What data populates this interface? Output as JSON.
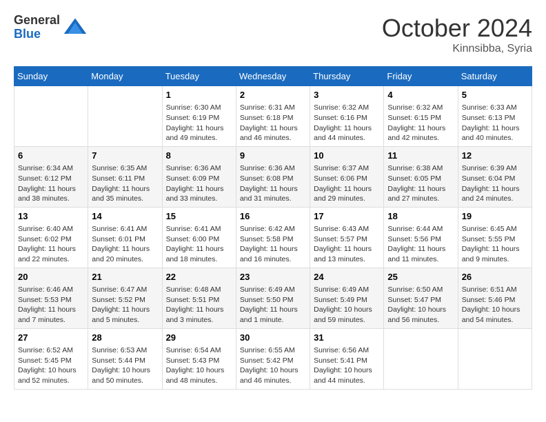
{
  "logo": {
    "general": "General",
    "blue": "Blue"
  },
  "title": {
    "month_year": "October 2024",
    "location": "Kinnsibba, Syria"
  },
  "weekdays": [
    "Sunday",
    "Monday",
    "Tuesday",
    "Wednesday",
    "Thursday",
    "Friday",
    "Saturday"
  ],
  "weeks": [
    [
      {
        "day": null
      },
      {
        "day": null
      },
      {
        "day": "1",
        "sunrise": "Sunrise: 6:30 AM",
        "sunset": "Sunset: 6:19 PM",
        "daylight": "Daylight: 11 hours and 49 minutes."
      },
      {
        "day": "2",
        "sunrise": "Sunrise: 6:31 AM",
        "sunset": "Sunset: 6:18 PM",
        "daylight": "Daylight: 11 hours and 46 minutes."
      },
      {
        "day": "3",
        "sunrise": "Sunrise: 6:32 AM",
        "sunset": "Sunset: 6:16 PM",
        "daylight": "Daylight: 11 hours and 44 minutes."
      },
      {
        "day": "4",
        "sunrise": "Sunrise: 6:32 AM",
        "sunset": "Sunset: 6:15 PM",
        "daylight": "Daylight: 11 hours and 42 minutes."
      },
      {
        "day": "5",
        "sunrise": "Sunrise: 6:33 AM",
        "sunset": "Sunset: 6:13 PM",
        "daylight": "Daylight: 11 hours and 40 minutes."
      }
    ],
    [
      {
        "day": "6",
        "sunrise": "Sunrise: 6:34 AM",
        "sunset": "Sunset: 6:12 PM",
        "daylight": "Daylight: 11 hours and 38 minutes."
      },
      {
        "day": "7",
        "sunrise": "Sunrise: 6:35 AM",
        "sunset": "Sunset: 6:11 PM",
        "daylight": "Daylight: 11 hours and 35 minutes."
      },
      {
        "day": "8",
        "sunrise": "Sunrise: 6:36 AM",
        "sunset": "Sunset: 6:09 PM",
        "daylight": "Daylight: 11 hours and 33 minutes."
      },
      {
        "day": "9",
        "sunrise": "Sunrise: 6:36 AM",
        "sunset": "Sunset: 6:08 PM",
        "daylight": "Daylight: 11 hours and 31 minutes."
      },
      {
        "day": "10",
        "sunrise": "Sunrise: 6:37 AM",
        "sunset": "Sunset: 6:06 PM",
        "daylight": "Daylight: 11 hours and 29 minutes."
      },
      {
        "day": "11",
        "sunrise": "Sunrise: 6:38 AM",
        "sunset": "Sunset: 6:05 PM",
        "daylight": "Daylight: 11 hours and 27 minutes."
      },
      {
        "day": "12",
        "sunrise": "Sunrise: 6:39 AM",
        "sunset": "Sunset: 6:04 PM",
        "daylight": "Daylight: 11 hours and 24 minutes."
      }
    ],
    [
      {
        "day": "13",
        "sunrise": "Sunrise: 6:40 AM",
        "sunset": "Sunset: 6:02 PM",
        "daylight": "Daylight: 11 hours and 22 minutes."
      },
      {
        "day": "14",
        "sunrise": "Sunrise: 6:41 AM",
        "sunset": "Sunset: 6:01 PM",
        "daylight": "Daylight: 11 hours and 20 minutes."
      },
      {
        "day": "15",
        "sunrise": "Sunrise: 6:41 AM",
        "sunset": "Sunset: 6:00 PM",
        "daylight": "Daylight: 11 hours and 18 minutes."
      },
      {
        "day": "16",
        "sunrise": "Sunrise: 6:42 AM",
        "sunset": "Sunset: 5:58 PM",
        "daylight": "Daylight: 11 hours and 16 minutes."
      },
      {
        "day": "17",
        "sunrise": "Sunrise: 6:43 AM",
        "sunset": "Sunset: 5:57 PM",
        "daylight": "Daylight: 11 hours and 13 minutes."
      },
      {
        "day": "18",
        "sunrise": "Sunrise: 6:44 AM",
        "sunset": "Sunset: 5:56 PM",
        "daylight": "Daylight: 11 hours and 11 minutes."
      },
      {
        "day": "19",
        "sunrise": "Sunrise: 6:45 AM",
        "sunset": "Sunset: 5:55 PM",
        "daylight": "Daylight: 11 hours and 9 minutes."
      }
    ],
    [
      {
        "day": "20",
        "sunrise": "Sunrise: 6:46 AM",
        "sunset": "Sunset: 5:53 PM",
        "daylight": "Daylight: 11 hours and 7 minutes."
      },
      {
        "day": "21",
        "sunrise": "Sunrise: 6:47 AM",
        "sunset": "Sunset: 5:52 PM",
        "daylight": "Daylight: 11 hours and 5 minutes."
      },
      {
        "day": "22",
        "sunrise": "Sunrise: 6:48 AM",
        "sunset": "Sunset: 5:51 PM",
        "daylight": "Daylight: 11 hours and 3 minutes."
      },
      {
        "day": "23",
        "sunrise": "Sunrise: 6:49 AM",
        "sunset": "Sunset: 5:50 PM",
        "daylight": "Daylight: 11 hours and 1 minute."
      },
      {
        "day": "24",
        "sunrise": "Sunrise: 6:49 AM",
        "sunset": "Sunset: 5:49 PM",
        "daylight": "Daylight: 10 hours and 59 minutes."
      },
      {
        "day": "25",
        "sunrise": "Sunrise: 6:50 AM",
        "sunset": "Sunset: 5:47 PM",
        "daylight": "Daylight: 10 hours and 56 minutes."
      },
      {
        "day": "26",
        "sunrise": "Sunrise: 6:51 AM",
        "sunset": "Sunset: 5:46 PM",
        "daylight": "Daylight: 10 hours and 54 minutes."
      }
    ],
    [
      {
        "day": "27",
        "sunrise": "Sunrise: 6:52 AM",
        "sunset": "Sunset: 5:45 PM",
        "daylight": "Daylight: 10 hours and 52 minutes."
      },
      {
        "day": "28",
        "sunrise": "Sunrise: 6:53 AM",
        "sunset": "Sunset: 5:44 PM",
        "daylight": "Daylight: 10 hours and 50 minutes."
      },
      {
        "day": "29",
        "sunrise": "Sunrise: 6:54 AM",
        "sunset": "Sunset: 5:43 PM",
        "daylight": "Daylight: 10 hours and 48 minutes."
      },
      {
        "day": "30",
        "sunrise": "Sunrise: 6:55 AM",
        "sunset": "Sunset: 5:42 PM",
        "daylight": "Daylight: 10 hours and 46 minutes."
      },
      {
        "day": "31",
        "sunrise": "Sunrise: 6:56 AM",
        "sunset": "Sunset: 5:41 PM",
        "daylight": "Daylight: 10 hours and 44 minutes."
      },
      {
        "day": null
      },
      {
        "day": null
      }
    ]
  ]
}
